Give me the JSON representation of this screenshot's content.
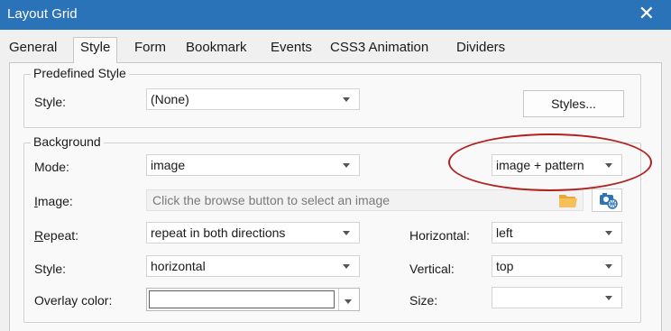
{
  "window": {
    "title": "Layout Grid",
    "close_glyph": "✕"
  },
  "tabs": [
    "General",
    "Style",
    "Form",
    "Bookmark",
    "Events",
    "CSS3 Animation",
    "Dividers"
  ],
  "active_tab": "Style",
  "predefined": {
    "group_title": "Predefined Style",
    "style_label": "Style:",
    "style_value": "(None)",
    "styles_button": "Styles..."
  },
  "background": {
    "group_title": "Background",
    "mode_label": "Mode:",
    "mode_value": "image",
    "mode_option_value": "image + pattern",
    "image_label_prefix": "I",
    "image_label_rest": "mage:",
    "image_placeholder": "Click the browse button to select an image",
    "repeat_label_prefix": "R",
    "repeat_label_rest": "epeat:",
    "repeat_value": "repeat in both directions",
    "horizontal_label": "Horizontal:",
    "horizontal_value": "left",
    "style_label": "Style:",
    "style_value": "horizontal",
    "vertical_label": "Vertical:",
    "vertical_value": "top",
    "overlay_label": "Overlay color:",
    "size_label": "Size:",
    "size_value": ""
  },
  "icons": {
    "browse": "folder-icon",
    "online": "camera-globe-icon"
  },
  "colors": {
    "titlebar": "#2b73b9",
    "highlight": "#b3211e"
  }
}
